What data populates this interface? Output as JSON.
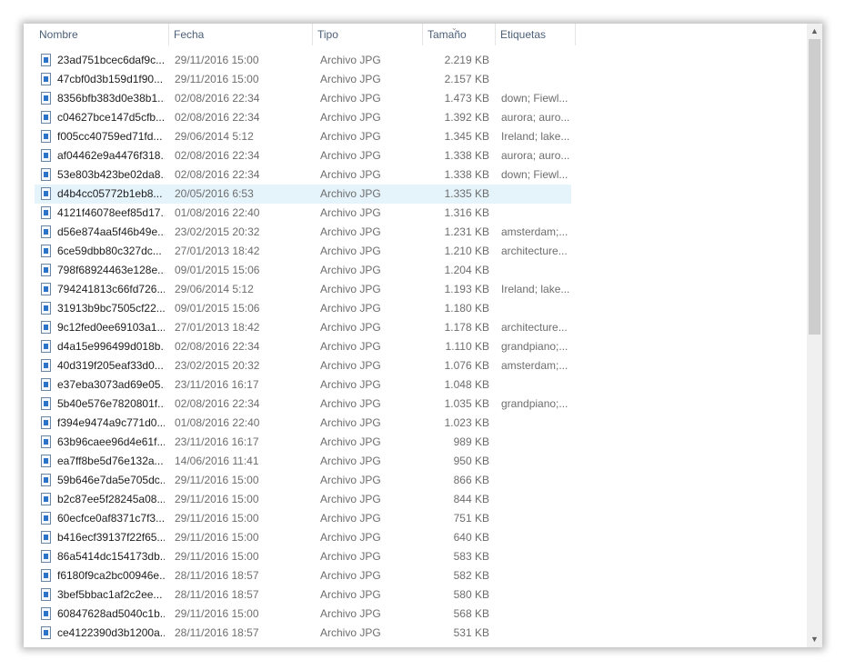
{
  "columns": {
    "name": "Nombre",
    "date": "Fecha",
    "type": "Tipo",
    "size": "Tamaño",
    "tags": "Etiquetas"
  },
  "sort_indicator": "⌄",
  "scroll": {
    "up": "▲",
    "down": "▼"
  },
  "selected_index": 7,
  "files": [
    {
      "name": "23ad751bcec6daf9c...",
      "date": "29/11/2016 15:00",
      "type": "Archivo JPG",
      "size": "2.219 KB",
      "tags": ""
    },
    {
      "name": "47cbf0d3b159d1f90...",
      "date": "29/11/2016 15:00",
      "type": "Archivo JPG",
      "size": "2.157 KB",
      "tags": ""
    },
    {
      "name": "8356bfb383d0e38b1...",
      "date": "02/08/2016 22:34",
      "type": "Archivo JPG",
      "size": "1.473 KB",
      "tags": "down; Fiewl..."
    },
    {
      "name": "c04627bce147d5cfb...",
      "date": "02/08/2016 22:34",
      "type": "Archivo JPG",
      "size": "1.392 KB",
      "tags": "aurora; auro..."
    },
    {
      "name": "f005cc40759ed71fd...",
      "date": "29/06/2014 5:12",
      "type": "Archivo JPG",
      "size": "1.345 KB",
      "tags": "Ireland; lake..."
    },
    {
      "name": "af04462e9a4476f318...",
      "date": "02/08/2016 22:34",
      "type": "Archivo JPG",
      "size": "1.338 KB",
      "tags": "aurora; auro..."
    },
    {
      "name": "53e803b423be02da8...",
      "date": "02/08/2016 22:34",
      "type": "Archivo JPG",
      "size": "1.338 KB",
      "tags": "down; Fiewl..."
    },
    {
      "name": "d4b4cc05772b1eb8...",
      "date": "20/05/2016 6:53",
      "type": "Archivo JPG",
      "size": "1.335 KB",
      "tags": ""
    },
    {
      "name": "4121f46078eef85d17...",
      "date": "01/08/2016 22:40",
      "type": "Archivo JPG",
      "size": "1.316 KB",
      "tags": ""
    },
    {
      "name": "d56e874aa5f46b49e...",
      "date": "23/02/2015 20:32",
      "type": "Archivo JPG",
      "size": "1.231 KB",
      "tags": "amsterdam;..."
    },
    {
      "name": "6ce59dbb80c327dc...",
      "date": "27/01/2013 18:42",
      "type": "Archivo JPG",
      "size": "1.210 KB",
      "tags": "architecture..."
    },
    {
      "name": "798f68924463e128e...",
      "date": "09/01/2015 15:06",
      "type": "Archivo JPG",
      "size": "1.204 KB",
      "tags": ""
    },
    {
      "name": "794241813c66fd726...",
      "date": "29/06/2014 5:12",
      "type": "Archivo JPG",
      "size": "1.193 KB",
      "tags": "Ireland; lake..."
    },
    {
      "name": "31913b9bc7505cf22...",
      "date": "09/01/2015 15:06",
      "type": "Archivo JPG",
      "size": "1.180 KB",
      "tags": ""
    },
    {
      "name": "9c12fed0ee69103a1...",
      "date": "27/01/2013 18:42",
      "type": "Archivo JPG",
      "size": "1.178 KB",
      "tags": "architecture..."
    },
    {
      "name": "d4a15e996499d018b...",
      "date": "02/08/2016 22:34",
      "type": "Archivo JPG",
      "size": "1.110 KB",
      "tags": "grandpiano;..."
    },
    {
      "name": "40d319f205eaf33d0...",
      "date": "23/02/2015 20:32",
      "type": "Archivo JPG",
      "size": "1.076 KB",
      "tags": "amsterdam;..."
    },
    {
      "name": "e37eba3073ad69e05...",
      "date": "23/11/2016 16:17",
      "type": "Archivo JPG",
      "size": "1.048 KB",
      "tags": ""
    },
    {
      "name": "5b40e576e7820801f...",
      "date": "02/08/2016 22:34",
      "type": "Archivo JPG",
      "size": "1.035 KB",
      "tags": "grandpiano;..."
    },
    {
      "name": "f394e9474a9c771d0...",
      "date": "01/08/2016 22:40",
      "type": "Archivo JPG",
      "size": "1.023 KB",
      "tags": ""
    },
    {
      "name": "63b96caee96d4e61f...",
      "date": "23/11/2016 16:17",
      "type": "Archivo JPG",
      "size": "989 KB",
      "tags": ""
    },
    {
      "name": "ea7ff8be5d76e132a...",
      "date": "14/06/2016 11:41",
      "type": "Archivo JPG",
      "size": "950 KB",
      "tags": ""
    },
    {
      "name": "59b646e7da5e705dc...",
      "date": "29/11/2016 15:00",
      "type": "Archivo JPG",
      "size": "866 KB",
      "tags": ""
    },
    {
      "name": "b2c87ee5f28245a08...",
      "date": "29/11/2016 15:00",
      "type": "Archivo JPG",
      "size": "844 KB",
      "tags": ""
    },
    {
      "name": "60ecfce0af8371c7f3...",
      "date": "29/11/2016 15:00",
      "type": "Archivo JPG",
      "size": "751 KB",
      "tags": ""
    },
    {
      "name": "b416ecf39137f22f65...",
      "date": "29/11/2016 15:00",
      "type": "Archivo JPG",
      "size": "640 KB",
      "tags": ""
    },
    {
      "name": "86a5414dc154173db...",
      "date": "29/11/2016 15:00",
      "type": "Archivo JPG",
      "size": "583 KB",
      "tags": ""
    },
    {
      "name": "f6180f9ca2bc00946e...",
      "date": "28/11/2016 18:57",
      "type": "Archivo JPG",
      "size": "582 KB",
      "tags": ""
    },
    {
      "name": "3bef5bbac1af2c2ee...",
      "date": "28/11/2016 18:57",
      "type": "Archivo JPG",
      "size": "580 KB",
      "tags": ""
    },
    {
      "name": "60847628ad5040c1b...",
      "date": "29/11/2016 15:00",
      "type": "Archivo JPG",
      "size": "568 KB",
      "tags": ""
    },
    {
      "name": "ce4122390d3b1200a...",
      "date": "28/11/2016 18:57",
      "type": "Archivo JPG",
      "size": "531 KB",
      "tags": ""
    }
  ]
}
